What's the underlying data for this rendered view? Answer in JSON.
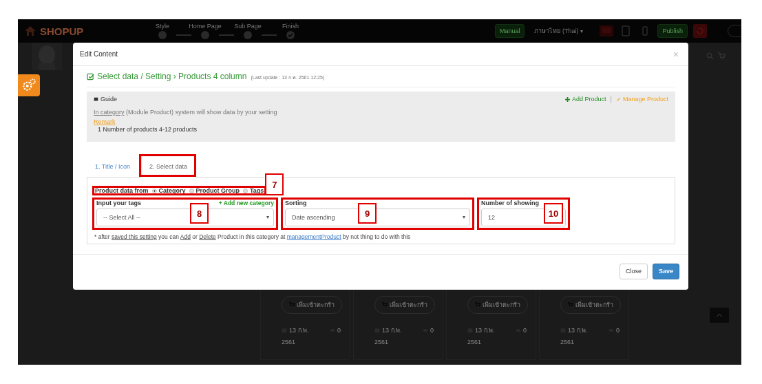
{
  "background_page": {
    "logo": "SHOPUP",
    "steps": [
      {
        "label": "Style",
        "kind": "dot"
      },
      {
        "label": "Home Page",
        "kind": "dot"
      },
      {
        "label": "Sub Page",
        "kind": "dot"
      },
      {
        "label": "Finish",
        "kind": "check"
      }
    ],
    "manual_button": "Manual",
    "language": "ภาษาไทย (Thai)",
    "publish_button": "Publish",
    "product_cards": [
      {
        "button": "เพิ่มเข้าตะกร้า",
        "date": "13 ก.พ.",
        "year": "2561",
        "views": "0"
      },
      {
        "button": "เพิ่มเข้าตะกร้า",
        "date": "13 ก.พ.",
        "year": "2561",
        "views": "0"
      },
      {
        "button": "เพิ่มเข้าตะกร้า",
        "date": "13 ก.พ.",
        "year": "2561",
        "views": "0"
      },
      {
        "button": "เพิ่มเข้าตะกร้า",
        "date": "13 ก.พ.",
        "year": "2561",
        "views": "0"
      }
    ]
  },
  "modal": {
    "title": "Edit Content",
    "close": "×",
    "heading": "Select data / Setting › Products 4 column",
    "last_update": "(Last update : 13 ก.พ. 2561 12:25)",
    "guide": {
      "title": "Guide",
      "add_link": "Add Product",
      "separator": "|",
      "manage_link": "Manage Product",
      "text": [
        {
          "text": "In category",
          "kind": "underline"
        },
        {
          "text": " (Module Product) system will show data by your setting",
          "kind": "plain"
        }
      ],
      "remark": "Remark",
      "remark_item": "1 Number of products 4-12 products"
    },
    "tabs": [
      {
        "label": "1. Title / Icon",
        "selected": false,
        "annotated": false
      },
      {
        "label": "2. Select data",
        "selected": true,
        "annotated": true
      }
    ],
    "source": {
      "label": "Product data from",
      "annotation": "7",
      "options": [
        {
          "label": "Category",
          "selected": true
        },
        {
          "label": "Product Group",
          "selected": false
        },
        {
          "label": "Tags",
          "selected": false
        }
      ]
    },
    "fields": [
      {
        "kind": "tags",
        "label": "Input your tags",
        "link": "+ Add new category",
        "value": "-- Select All --",
        "annotation": "8"
      },
      {
        "kind": "sorting",
        "label": "Sorting",
        "value": "Date ascending",
        "annotation": "9"
      },
      {
        "kind": "number",
        "label": "Number of showing",
        "value": "12",
        "annotation": "10"
      }
    ],
    "note": [
      {
        "text": "* after ",
        "kind": "plain"
      },
      {
        "text": "saved this setting",
        "kind": "underline"
      },
      {
        "text": " you can ",
        "kind": "plain"
      },
      {
        "text": "Add",
        "kind": "underline"
      },
      {
        "text": " or ",
        "kind": "plain"
      },
      {
        "text": "Delete",
        "kind": "underline"
      },
      {
        "text": " Product in this category at ",
        "kind": "plain"
      },
      {
        "text": "managementProduct",
        "kind": "link"
      },
      {
        "text": " by not thing to do with this",
        "kind": "plain"
      }
    ],
    "buttons": [
      {
        "label": "Close",
        "kind": "default"
      },
      {
        "label": "Save",
        "kind": "primary"
      }
    ]
  }
}
